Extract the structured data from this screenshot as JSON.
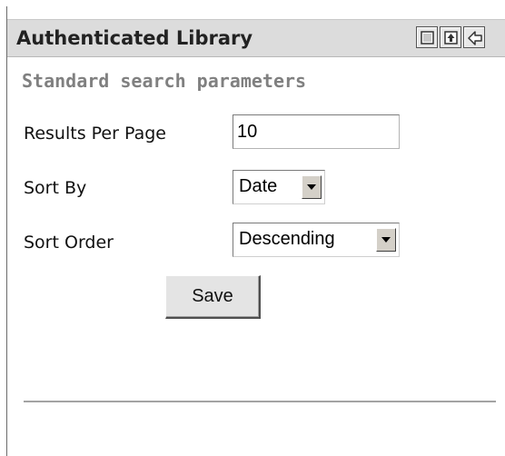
{
  "portlet": {
    "title": "Authenticated Library",
    "controls": [
      "minimize-icon",
      "maximize-icon",
      "back-icon"
    ]
  },
  "section": {
    "title": "Standard search parameters"
  },
  "form": {
    "results_per_page": {
      "label": "Results Per Page",
      "value": "10"
    },
    "sort_by": {
      "label": "Sort By",
      "selected": "Date"
    },
    "sort_order": {
      "label": "Sort Order",
      "selected": "Descending"
    },
    "save_label": "Save"
  },
  "colors": {
    "titlebar_bg": "#dcdcdc",
    "section_title": "#808080",
    "divider": "#a3a3a3"
  }
}
